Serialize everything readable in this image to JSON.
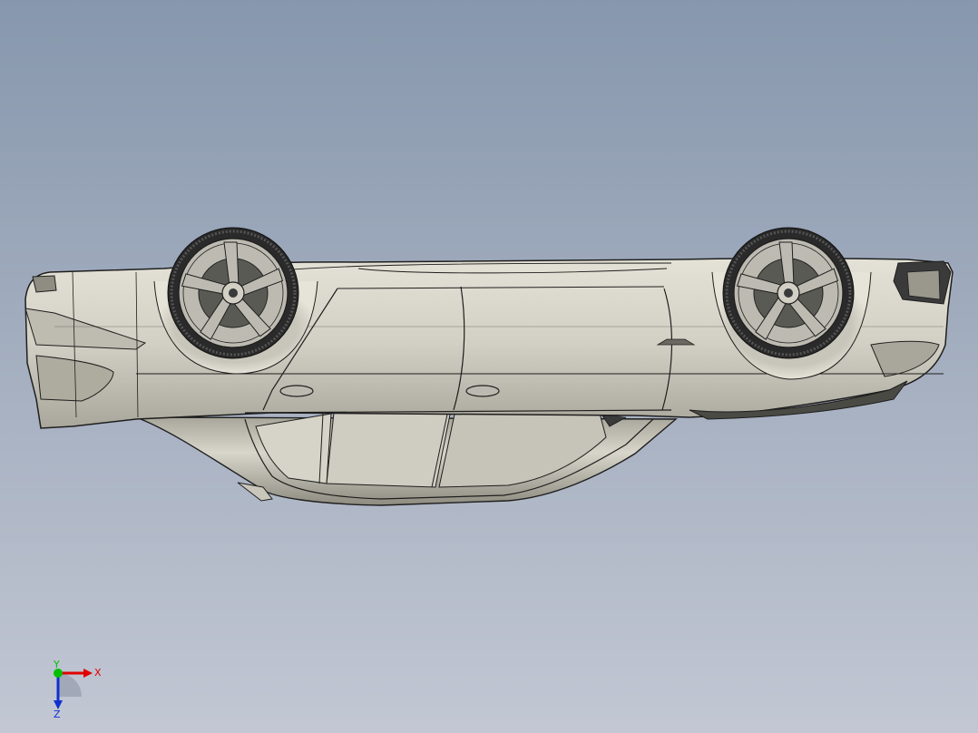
{
  "viewport": {
    "background_top": "#8797ad",
    "background_bottom": "#c2c7d3"
  },
  "model": {
    "body_color": "#d2d0c4",
    "body_shade": "#9a988c",
    "edge_color": "#1e1e1e",
    "tire_color": "#2a2a2a",
    "rim_color": "#bdbbb1"
  },
  "triad": {
    "x_label": "X",
    "y_label": "Y",
    "z_label": "Z",
    "x_color": "#e00000",
    "y_color": "#00c000",
    "z_color": "#1030d0"
  }
}
